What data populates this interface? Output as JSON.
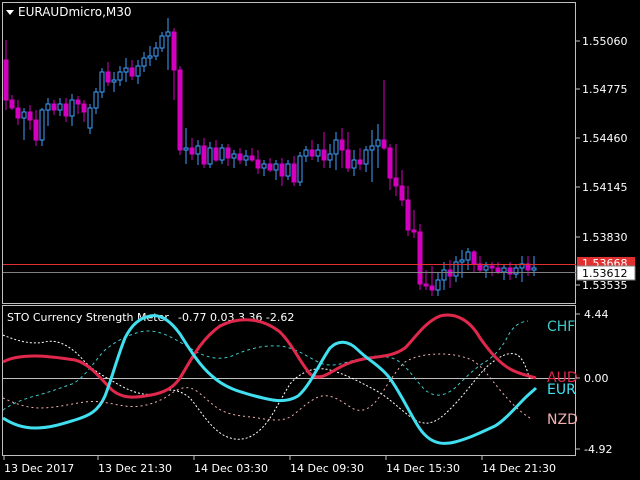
{
  "main": {
    "symbol_label": "EURAUDmicro,M30",
    "price_axis_labels": [
      "1.55060",
      "1.54775",
      "1.54460",
      "1.54145",
      "1.53830",
      "1.53535"
    ],
    "price_tags": {
      "ask": "1.53668",
      "bid": "1.53612"
    },
    "colors": {
      "bull": "#3ea0ff",
      "bear": "#d400c0",
      "ask_line": "#e03030",
      "bid_line": "#808080"
    }
  },
  "indicator": {
    "title": "STO Currency Strength Meter",
    "values_text": "-0.77 0.03 3.36 -2.62",
    "scale_labels": [
      "4.44",
      "0.00",
      "-4.92"
    ],
    "currencies": [
      {
        "label": "CHF",
        "color": "#3ec8c8"
      },
      {
        "label": "AUD",
        "color": "#e0284c"
      },
      {
        "label": "EUR",
        "color": "#40e0f0"
      },
      {
        "label": "NZD",
        "color": "#f0b0b0"
      }
    ]
  },
  "time_axis": {
    "labels": [
      "13 Dec 2017",
      "13 Dec 21:30",
      "14 Dec 03:30",
      "14 Dec 09:30",
      "14 Dec 15:30",
      "14 Dec 21:30"
    ]
  }
}
